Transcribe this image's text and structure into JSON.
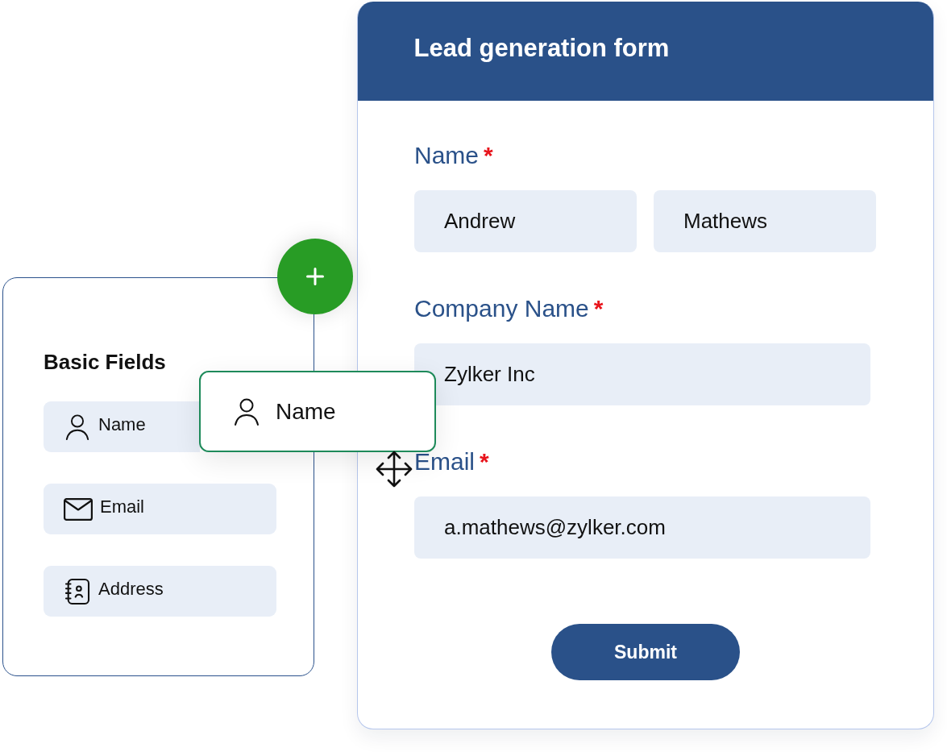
{
  "field_palette": {
    "title": "Basic Fields",
    "items": [
      {
        "kind": "name",
        "label": "Name"
      },
      {
        "kind": "email",
        "label": "Email"
      },
      {
        "kind": "address",
        "label": "Address"
      }
    ]
  },
  "dragged_field": {
    "kind": "name",
    "label": "Name"
  },
  "form": {
    "title": "Lead generation form",
    "fields": [
      {
        "label": "Name",
        "required_mark": "*",
        "values": [
          "Andrew",
          "Mathews"
        ]
      },
      {
        "label": "Company Name",
        "required_mark": "*",
        "values": [
          "Zylker Inc"
        ]
      },
      {
        "label": "Email",
        "required_mark": "*",
        "values": [
          "a.mathews@zylker.com"
        ]
      }
    ],
    "submit_label": "Submit"
  }
}
